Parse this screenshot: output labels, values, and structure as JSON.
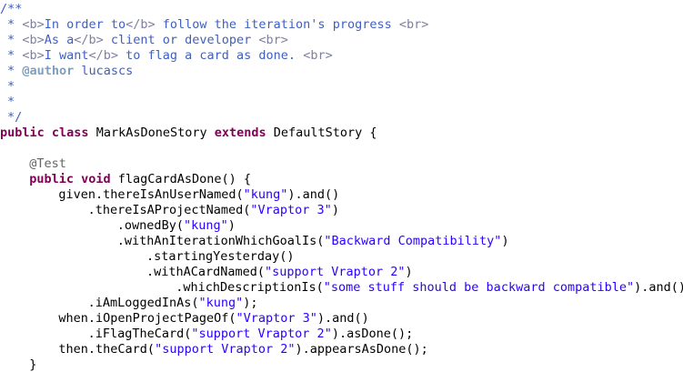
{
  "editor": {
    "lines": [
      {
        "indent": "",
        "tokens": [
          {
            "t": "/**",
            "c": "jd"
          }
        ]
      },
      {
        "indent": " ",
        "tokens": [
          {
            "t": "* ",
            "c": "jd"
          },
          {
            "t": "<b>",
            "c": "jdtag"
          },
          {
            "t": "In order to",
            "c": "jd"
          },
          {
            "t": "</b>",
            "c": "jdtag"
          },
          {
            "t": " follow the iteration's progress ",
            "c": "jd"
          },
          {
            "t": "<br>",
            "c": "jdtag"
          }
        ]
      },
      {
        "indent": " ",
        "tokens": [
          {
            "t": "* ",
            "c": "jd"
          },
          {
            "t": "<b>",
            "c": "jdtag"
          },
          {
            "t": "As a",
            "c": "jd"
          },
          {
            "t": "</b>",
            "c": "jdtag"
          },
          {
            "t": " client or developer ",
            "c": "jd"
          },
          {
            "t": "<br>",
            "c": "jdtag"
          }
        ]
      },
      {
        "indent": " ",
        "tokens": [
          {
            "t": "* ",
            "c": "jd"
          },
          {
            "t": "<b>",
            "c": "jdtag"
          },
          {
            "t": "I want",
            "c": "jd"
          },
          {
            "t": "</b>",
            "c": "jdtag"
          },
          {
            "t": " to flag a card as done. ",
            "c": "jd"
          },
          {
            "t": "<br>",
            "c": "jdtag"
          }
        ]
      },
      {
        "indent": " ",
        "tokens": [
          {
            "t": "* ",
            "c": "jd"
          },
          {
            "t": "@author",
            "c": "jdat"
          },
          {
            "t": " lucascs",
            "c": "jd"
          }
        ]
      },
      {
        "indent": " ",
        "tokens": [
          {
            "t": "*",
            "c": "jd"
          }
        ]
      },
      {
        "indent": " ",
        "tokens": [
          {
            "t": "*",
            "c": "jd"
          }
        ]
      },
      {
        "indent": " ",
        "tokens": [
          {
            "t": "*/",
            "c": "jd"
          }
        ]
      },
      {
        "indent": "",
        "tokens": [
          {
            "t": "public",
            "c": "kw"
          },
          {
            "t": " ",
            "c": "pl"
          },
          {
            "t": "class",
            "c": "kw"
          },
          {
            "t": " MarkAsDoneStory ",
            "c": "pl"
          },
          {
            "t": "extends",
            "c": "kw"
          },
          {
            "t": " DefaultStory {",
            "c": "pl"
          }
        ]
      },
      {
        "indent": "",
        "tokens": []
      },
      {
        "indent": "    ",
        "tokens": [
          {
            "t": "@Test",
            "c": "ann"
          }
        ]
      },
      {
        "indent": "    ",
        "tokens": [
          {
            "t": "public",
            "c": "kw"
          },
          {
            "t": " ",
            "c": "pl"
          },
          {
            "t": "void",
            "c": "kw"
          },
          {
            "t": " flagCardAsDone() {",
            "c": "pl"
          }
        ]
      },
      {
        "indent": "        ",
        "tokens": [
          {
            "t": "given.thereIsAnUserNamed(",
            "c": "pl"
          },
          {
            "t": "\"kung\"",
            "c": "str"
          },
          {
            "t": ").and()",
            "c": "pl"
          }
        ]
      },
      {
        "indent": "            ",
        "tokens": [
          {
            "t": ".thereIsAProjectNamed(",
            "c": "pl"
          },
          {
            "t": "\"Vraptor 3\"",
            "c": "str"
          },
          {
            "t": ")",
            "c": "pl"
          }
        ]
      },
      {
        "indent": "                ",
        "tokens": [
          {
            "t": ".ownedBy(",
            "c": "pl"
          },
          {
            "t": "\"kung\"",
            "c": "str"
          },
          {
            "t": ")",
            "c": "pl"
          }
        ]
      },
      {
        "indent": "                ",
        "tokens": [
          {
            "t": ".withAnIterationWhichGoalIs(",
            "c": "pl"
          },
          {
            "t": "\"Backward Compatibility\"",
            "c": "str"
          },
          {
            "t": ")",
            "c": "pl"
          }
        ]
      },
      {
        "indent": "                    ",
        "tokens": [
          {
            "t": ".startingYesterday()",
            "c": "pl"
          }
        ]
      },
      {
        "indent": "                    ",
        "tokens": [
          {
            "t": ".withACardNamed(",
            "c": "pl"
          },
          {
            "t": "\"support Vraptor 2\"",
            "c": "str"
          },
          {
            "t": ")",
            "c": "pl"
          }
        ]
      },
      {
        "indent": "                        ",
        "tokens": [
          {
            "t": ".whichDescriptionIs(",
            "c": "pl"
          },
          {
            "t": "\"some stuff should be backward compatible\"",
            "c": "str"
          },
          {
            "t": ").and()",
            "c": "pl"
          }
        ]
      },
      {
        "indent": "            ",
        "tokens": [
          {
            "t": ".iAmLoggedInAs(",
            "c": "pl"
          },
          {
            "t": "\"kung\"",
            "c": "str"
          },
          {
            "t": ");",
            "c": "pl"
          }
        ]
      },
      {
        "indent": "        ",
        "tokens": [
          {
            "t": "when.iOpenProjectPageOf(",
            "c": "pl"
          },
          {
            "t": "\"Vraptor 3\"",
            "c": "str"
          },
          {
            "t": ").and()",
            "c": "pl"
          }
        ]
      },
      {
        "indent": "            ",
        "tokens": [
          {
            "t": ".iFlagTheCard(",
            "c": "pl"
          },
          {
            "t": "\"support Vraptor 2\"",
            "c": "str"
          },
          {
            "t": ").asDone();",
            "c": "pl"
          }
        ]
      },
      {
        "indent": "        ",
        "tokens": [
          {
            "t": "then.theCard(",
            "c": "pl"
          },
          {
            "t": "\"support Vraptor 2\"",
            "c": "str"
          },
          {
            "t": ").appearsAsDone();",
            "c": "pl"
          }
        ]
      },
      {
        "indent": "    ",
        "tokens": [
          {
            "t": "}",
            "c": "pl"
          }
        ]
      },
      {
        "indent": "",
        "tokens": [
          {
            "t": "}",
            "c": "pl"
          }
        ]
      }
    ]
  }
}
